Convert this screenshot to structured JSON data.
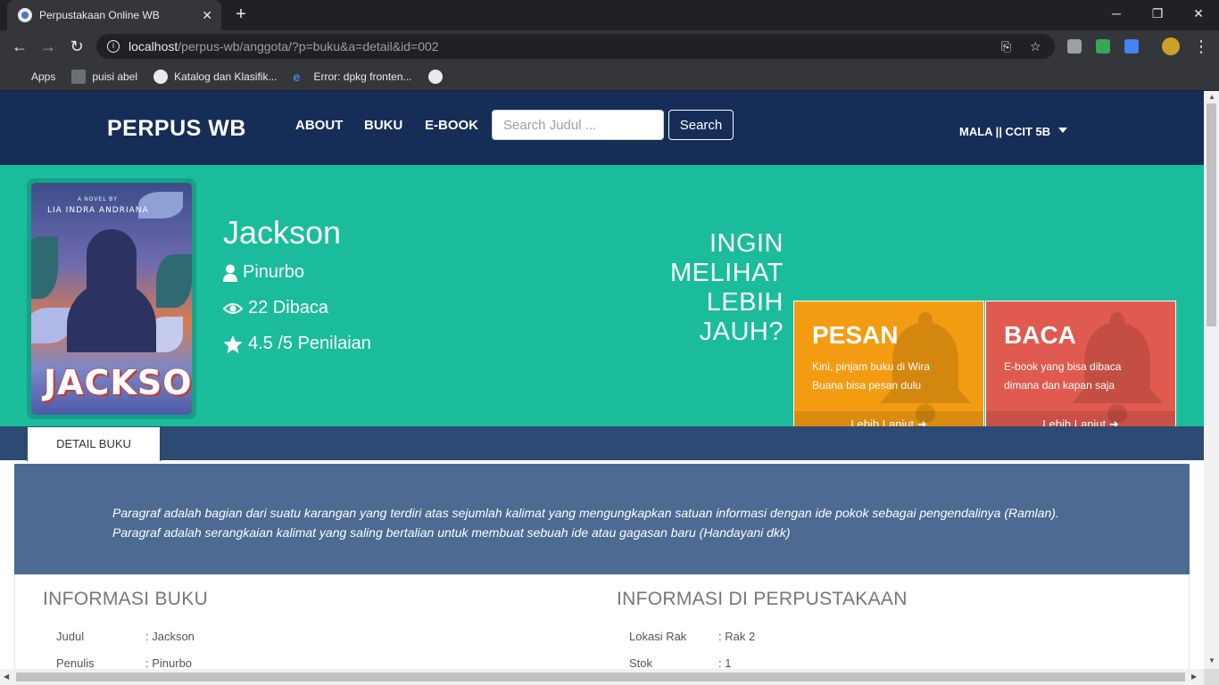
{
  "browser": {
    "tab_title": "Perpustakaan Online WB",
    "url_host": "localhost",
    "url_path": "/perpus-wb/anggota/?p=buku&a=detail&id=002",
    "bookmarks": [
      {
        "label": "Apps"
      },
      {
        "label": "puisi abel"
      },
      {
        "label": "Katalog dan Klasifik..."
      },
      {
        "label": "Error: dpkg fronten..."
      }
    ]
  },
  "nav": {
    "brand": "PERPUS WB",
    "links": [
      "ABOUT",
      "BUKU",
      "E-BOOK"
    ],
    "search_placeholder": "Search Judul ...",
    "search_button": "Search",
    "user": "MALA || CCIT 5B"
  },
  "book": {
    "title": "Jackson",
    "author": "Pinurbo",
    "reads": "22 Dibaca",
    "rating": "4.5 /5 Penilaian",
    "cover": {
      "subtitle": "A NOVEL BY",
      "author": "LIA INDRA ANDRIANA",
      "title": "JACKSON"
    }
  },
  "promo": {
    "heading_lines": [
      "INGIN",
      "MELIHAT",
      "LEBIH JAUH?"
    ],
    "cards": [
      {
        "title": "PESAN",
        "desc": "Kini, pinjam buku di Wira Buana bisa pesan dulu",
        "link": "Lebih Lanjut",
        "color": "#f39c12"
      },
      {
        "title": "BACA",
        "desc": "E-book yang bisa dibaca dimana dan kapan saja",
        "link": "Lebih Lanjut",
        "color": "#e05a4f"
      }
    ]
  },
  "tabs": {
    "active": "DETAIL BUKU"
  },
  "quote": {
    "line1": "Paragraf adalah bagian dari suatu karangan yang terdiri atas sejumlah kalimat yang mengungkapkan satuan informasi dengan ide pokok sebagai pengendalinya (Ramlan).",
    "line2": "Paragraf adalah serangkaian kalimat yang saling bertalian untuk membuat sebuah ide atau gagasan baru (Handayani dkk)"
  },
  "info_buku": {
    "heading": "INFORMASI BUKU",
    "rows": [
      {
        "label": "Judul",
        "value": ": Jackson"
      },
      {
        "label": "Penulis",
        "value": ": Pinurbo"
      }
    ]
  },
  "info_perpus": {
    "heading": "INFORMASI DI PERPUSTAKAAN",
    "rows": [
      {
        "label": "Lokasi Rak",
        "value": ": Rak 2"
      },
      {
        "label": "Stok",
        "value": ": 1"
      }
    ]
  },
  "colors": {
    "navbar": "#162d57",
    "hero": "#1abc9c",
    "tabsbar": "#2d4a74",
    "quote_bg": "#4d6b92"
  }
}
